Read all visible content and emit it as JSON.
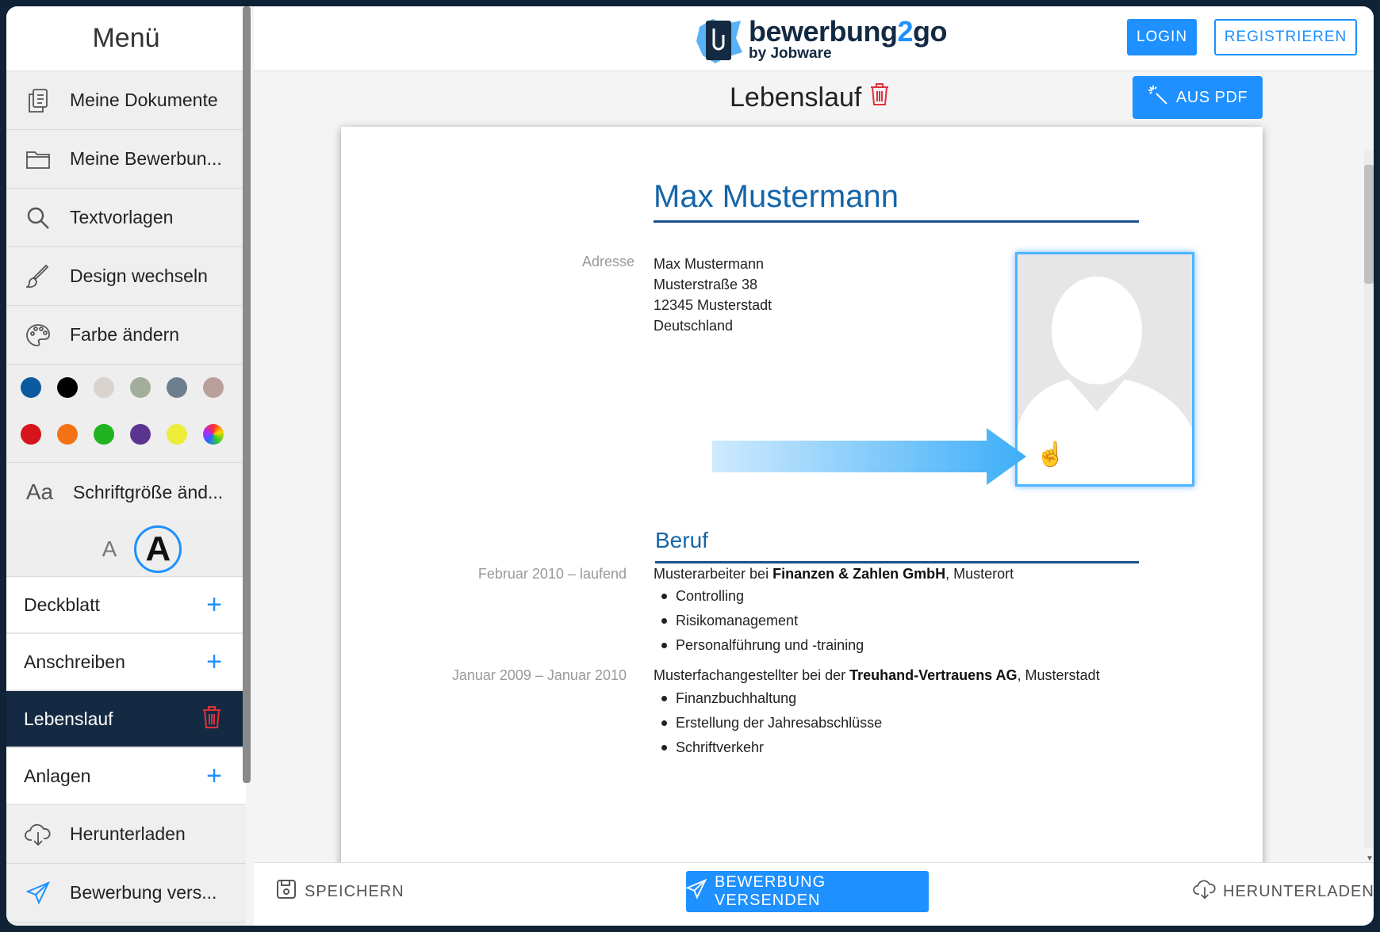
{
  "sidebar": {
    "title": "Menü",
    "items": [
      {
        "label": "Meine Dokumente",
        "icon": "documents-icon"
      },
      {
        "label": "Meine Bewerbun...",
        "icon": "folder-icon"
      },
      {
        "label": "Textvorlagen",
        "icon": "search-icon"
      },
      {
        "label": "Design wechseln",
        "icon": "brush-icon"
      },
      {
        "label": "Farbe ändern",
        "icon": "palette-icon"
      }
    ],
    "colors": [
      "#0b5aa0",
      "#000000",
      "#d9d3d0",
      "#a3ad9b",
      "#6d7f8f",
      "#b9a09a",
      "#d6141b",
      "#f47216",
      "#1fb41f",
      "#5a3590",
      "#eded3a",
      "multicolor"
    ],
    "font_size_item": {
      "label": "Schriftgröße änd...",
      "icon": "font-size-icon"
    },
    "font_small": "A",
    "font_big": "A",
    "sections": [
      {
        "label": "Deckblatt",
        "action": "plus-icon"
      },
      {
        "label": "Anschreiben",
        "action": "plus-icon"
      },
      {
        "label": "Lebenslauf",
        "action": "trash-icon",
        "active": true
      },
      {
        "label": "Anlagen",
        "action": "plus-icon"
      }
    ],
    "bottom_items": [
      {
        "label": "Herunterladen",
        "icon": "cloud-download-icon"
      },
      {
        "label": "Bewerbung vers...",
        "icon": "send-icon"
      }
    ]
  },
  "header": {
    "logo_main_a": "bewerbung",
    "logo_main_b": "2",
    "logo_main_c": "go",
    "logo_sub": "by Jobware",
    "login": "LOGIN",
    "register": "REGISTRIEREN"
  },
  "document": {
    "title": "Lebenslauf",
    "from_pdf": "AUS PDF",
    "name": "Max Mustermann",
    "address_label": "Adresse",
    "address": [
      "Max Mustermann",
      "Musterstraße 38",
      "12345 Musterstadt",
      "Deutschland"
    ],
    "section": "Beruf",
    "jobs": [
      {
        "date": "Februar 2010 – laufend",
        "prefix": "Musterarbeiter bei ",
        "company": "Finanzen & Zahlen GmbH",
        "suffix": ", Musterort",
        "tasks": [
          "Controlling",
          "Risikomanagement",
          "Personalführung und -training"
        ]
      },
      {
        "date": "Januar 2009 – Januar 2010",
        "prefix": "Musterfachangestellter bei der ",
        "company": "Treuhand-Vertrauens AG",
        "suffix": ", Musterstadt",
        "tasks": [
          "Finanzbuchhaltung",
          "Erstellung der Jahresabschlüsse",
          "Schriftverkehr"
        ]
      }
    ]
  },
  "bottom": {
    "save": "SPEICHERN",
    "send": "BEWERBUNG VERSENDEN",
    "download": "HERUNTERLADEN"
  },
  "colors": {
    "accent": "#1e90ff",
    "navy": "#142a42",
    "heading": "#1565a8",
    "danger": "#e0313b"
  }
}
